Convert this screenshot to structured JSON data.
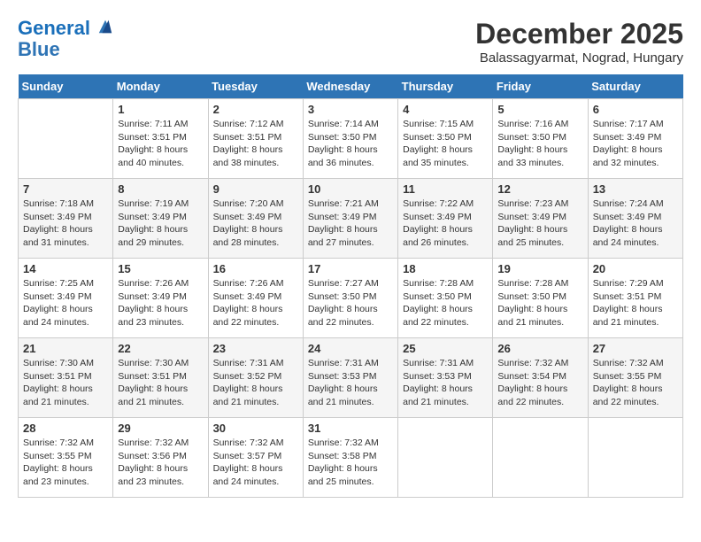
{
  "logo": {
    "line1": "General",
    "line2": "Blue"
  },
  "title": "December 2025",
  "subtitle": "Balassagyarmat, Nograd, Hungary",
  "header": {
    "days": [
      "Sunday",
      "Monday",
      "Tuesday",
      "Wednesday",
      "Thursday",
      "Friday",
      "Saturday"
    ]
  },
  "weeks": [
    [
      {
        "day": "",
        "info": ""
      },
      {
        "day": "1",
        "info": "Sunrise: 7:11 AM\nSunset: 3:51 PM\nDaylight: 8 hours\nand 40 minutes."
      },
      {
        "day": "2",
        "info": "Sunrise: 7:12 AM\nSunset: 3:51 PM\nDaylight: 8 hours\nand 38 minutes."
      },
      {
        "day": "3",
        "info": "Sunrise: 7:14 AM\nSunset: 3:50 PM\nDaylight: 8 hours\nand 36 minutes."
      },
      {
        "day": "4",
        "info": "Sunrise: 7:15 AM\nSunset: 3:50 PM\nDaylight: 8 hours\nand 35 minutes."
      },
      {
        "day": "5",
        "info": "Sunrise: 7:16 AM\nSunset: 3:50 PM\nDaylight: 8 hours\nand 33 minutes."
      },
      {
        "day": "6",
        "info": "Sunrise: 7:17 AM\nSunset: 3:49 PM\nDaylight: 8 hours\nand 32 minutes."
      }
    ],
    [
      {
        "day": "7",
        "info": "Sunrise: 7:18 AM\nSunset: 3:49 PM\nDaylight: 8 hours\nand 31 minutes."
      },
      {
        "day": "8",
        "info": "Sunrise: 7:19 AM\nSunset: 3:49 PM\nDaylight: 8 hours\nand 29 minutes."
      },
      {
        "day": "9",
        "info": "Sunrise: 7:20 AM\nSunset: 3:49 PM\nDaylight: 8 hours\nand 28 minutes."
      },
      {
        "day": "10",
        "info": "Sunrise: 7:21 AM\nSunset: 3:49 PM\nDaylight: 8 hours\nand 27 minutes."
      },
      {
        "day": "11",
        "info": "Sunrise: 7:22 AM\nSunset: 3:49 PM\nDaylight: 8 hours\nand 26 minutes."
      },
      {
        "day": "12",
        "info": "Sunrise: 7:23 AM\nSunset: 3:49 PM\nDaylight: 8 hours\nand 25 minutes."
      },
      {
        "day": "13",
        "info": "Sunrise: 7:24 AM\nSunset: 3:49 PM\nDaylight: 8 hours\nand 24 minutes."
      }
    ],
    [
      {
        "day": "14",
        "info": "Sunrise: 7:25 AM\nSunset: 3:49 PM\nDaylight: 8 hours\nand 24 minutes."
      },
      {
        "day": "15",
        "info": "Sunrise: 7:26 AM\nSunset: 3:49 PM\nDaylight: 8 hours\nand 23 minutes."
      },
      {
        "day": "16",
        "info": "Sunrise: 7:26 AM\nSunset: 3:49 PM\nDaylight: 8 hours\nand 22 minutes."
      },
      {
        "day": "17",
        "info": "Sunrise: 7:27 AM\nSunset: 3:50 PM\nDaylight: 8 hours\nand 22 minutes."
      },
      {
        "day": "18",
        "info": "Sunrise: 7:28 AM\nSunset: 3:50 PM\nDaylight: 8 hours\nand 22 minutes."
      },
      {
        "day": "19",
        "info": "Sunrise: 7:28 AM\nSunset: 3:50 PM\nDaylight: 8 hours\nand 21 minutes."
      },
      {
        "day": "20",
        "info": "Sunrise: 7:29 AM\nSunset: 3:51 PM\nDaylight: 8 hours\nand 21 minutes."
      }
    ],
    [
      {
        "day": "21",
        "info": "Sunrise: 7:30 AM\nSunset: 3:51 PM\nDaylight: 8 hours\nand 21 minutes."
      },
      {
        "day": "22",
        "info": "Sunrise: 7:30 AM\nSunset: 3:51 PM\nDaylight: 8 hours\nand 21 minutes."
      },
      {
        "day": "23",
        "info": "Sunrise: 7:31 AM\nSunset: 3:52 PM\nDaylight: 8 hours\nand 21 minutes."
      },
      {
        "day": "24",
        "info": "Sunrise: 7:31 AM\nSunset: 3:53 PM\nDaylight: 8 hours\nand 21 minutes."
      },
      {
        "day": "25",
        "info": "Sunrise: 7:31 AM\nSunset: 3:53 PM\nDaylight: 8 hours\nand 21 minutes."
      },
      {
        "day": "26",
        "info": "Sunrise: 7:32 AM\nSunset: 3:54 PM\nDaylight: 8 hours\nand 22 minutes."
      },
      {
        "day": "27",
        "info": "Sunrise: 7:32 AM\nSunset: 3:55 PM\nDaylight: 8 hours\nand 22 minutes."
      }
    ],
    [
      {
        "day": "28",
        "info": "Sunrise: 7:32 AM\nSunset: 3:55 PM\nDaylight: 8 hours\nand 23 minutes."
      },
      {
        "day": "29",
        "info": "Sunrise: 7:32 AM\nSunset: 3:56 PM\nDaylight: 8 hours\nand 23 minutes."
      },
      {
        "day": "30",
        "info": "Sunrise: 7:32 AM\nSunset: 3:57 PM\nDaylight: 8 hours\nand 24 minutes."
      },
      {
        "day": "31",
        "info": "Sunrise: 7:32 AM\nSunset: 3:58 PM\nDaylight: 8 hours\nand 25 minutes."
      },
      {
        "day": "",
        "info": ""
      },
      {
        "day": "",
        "info": ""
      },
      {
        "day": "",
        "info": ""
      }
    ]
  ]
}
